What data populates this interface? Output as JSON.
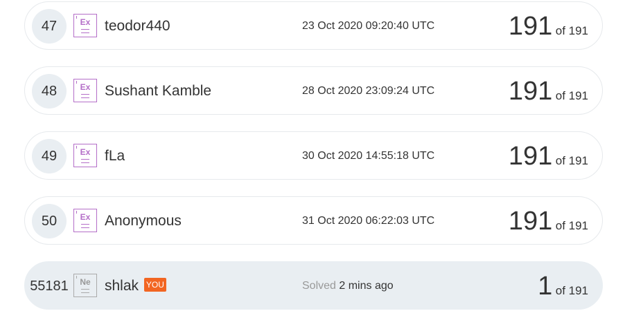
{
  "rows": [
    {
      "rank": "47",
      "level_icon": "level-badge-icon",
      "level_label": "Ex",
      "username": "teodor440",
      "solved": "23 Oct 2020 09:20:40 UTC",
      "score": "191",
      "of_label": "of 191"
    },
    {
      "rank": "48",
      "level_icon": "level-badge-icon",
      "level_label": "Ex",
      "username": "Sushant Kamble",
      "solved": "28 Oct 2020 23:09:24 UTC",
      "score": "191",
      "of_label": "of 191"
    },
    {
      "rank": "49",
      "level_icon": "level-badge-icon",
      "level_label": "Ex",
      "username": "fLa",
      "solved": "30 Oct 2020 14:55:18 UTC",
      "score": "191",
      "of_label": "of 191"
    },
    {
      "rank": "50",
      "level_icon": "level-badge-icon",
      "level_label": "Ex",
      "username": "Anonymous",
      "solved": "31 Oct 2020 06:22:03 UTC",
      "score": "191",
      "of_label": "of 191"
    }
  ],
  "current_user": {
    "rank": "55181",
    "level_icon": "level-badge-icon",
    "level_label": "Ne",
    "username": "shlak",
    "badge": "YOU",
    "solved_prefix": "Solved",
    "solved_time": "2 mins ago",
    "score": "1",
    "of_label": "of 191"
  },
  "colors": {
    "expert_level": "#b46ec8",
    "newbie_level": "#aaaaaa",
    "you_badge": "#f26522",
    "you_row_bg": "#e9eef2"
  }
}
